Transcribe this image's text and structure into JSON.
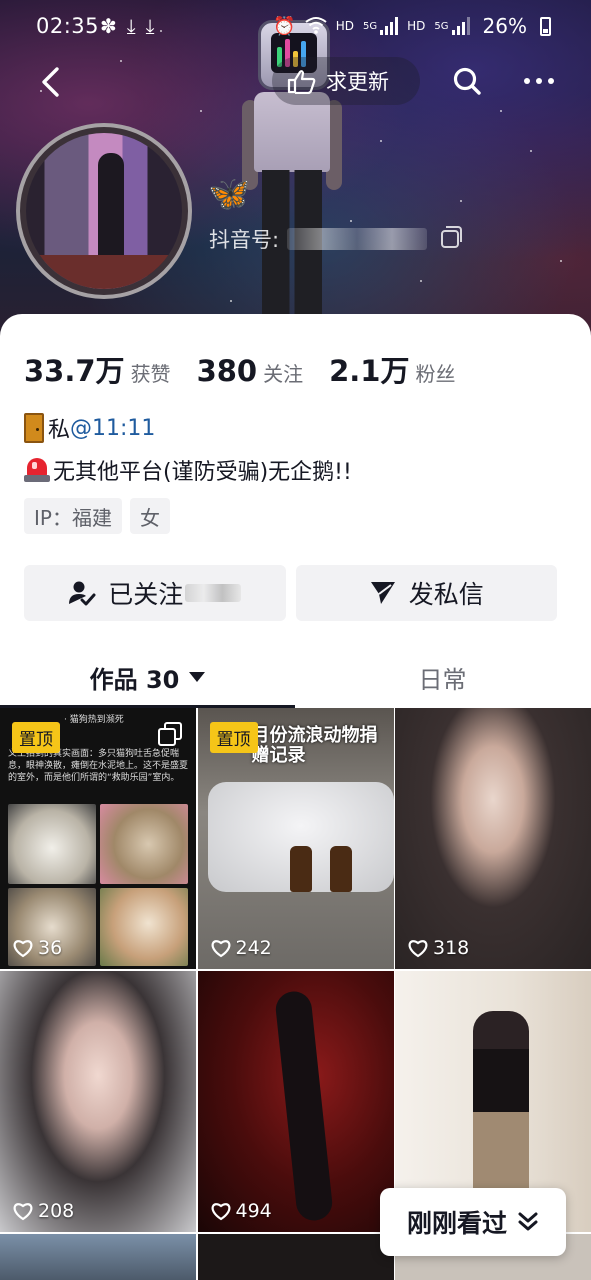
{
  "status_bar": {
    "time": "02:35",
    "left_icons": [
      "flower-icon",
      "download-icon",
      "download-icon"
    ],
    "right_labels": [
      "HD",
      "5G",
      "HD",
      "5G"
    ],
    "battery": "26%"
  },
  "nav": {
    "request_update_label": "求更新"
  },
  "profile": {
    "emoji_name": "🦋",
    "douyin_id_label": "抖音号:"
  },
  "stats": [
    {
      "value": "33.7万",
      "label": "获赞"
    },
    {
      "value": "380",
      "label": "关注"
    },
    {
      "value": "2.1万",
      "label": "粉丝"
    }
  ],
  "bio": {
    "line1_prefix": "私",
    "line1_mention": "@11:11",
    "line2": "无其他平台(谨防受骗)无企鹅!!"
  },
  "tags": [
    "IP：福建",
    "女"
  ],
  "actions": {
    "follow_label": "已关注",
    "message_label": "发私信"
  },
  "tabs": [
    {
      "label": "作品 30"
    },
    {
      "label": "日常"
    }
  ],
  "grid": {
    "pin_label": "置顶",
    "items": [
      {
        "likes": "36",
        "caption_top": "· 猫狗热到濒死",
        "caption": "义工拍到的真实画面：多只猫狗吐舌急促喘息，眼神涣散，瘫倒在水泥地上。这不是盛夏的室外，而是他们所谓的“救助乐园”室内。"
      },
      {
        "likes": "242",
        "title": "月份流浪动物捐赠记录"
      },
      {
        "likes": "318"
      },
      {
        "likes": "208"
      },
      {
        "likes": "494"
      },
      {
        "likes": ""
      }
    ]
  },
  "recent_button": {
    "label": "刚刚看过"
  },
  "colors": {
    "pin_bg": "#f5c518",
    "mention": "#1f5b9e",
    "primary_text": "#161823",
    "secondary_text": "#6b6d75"
  }
}
